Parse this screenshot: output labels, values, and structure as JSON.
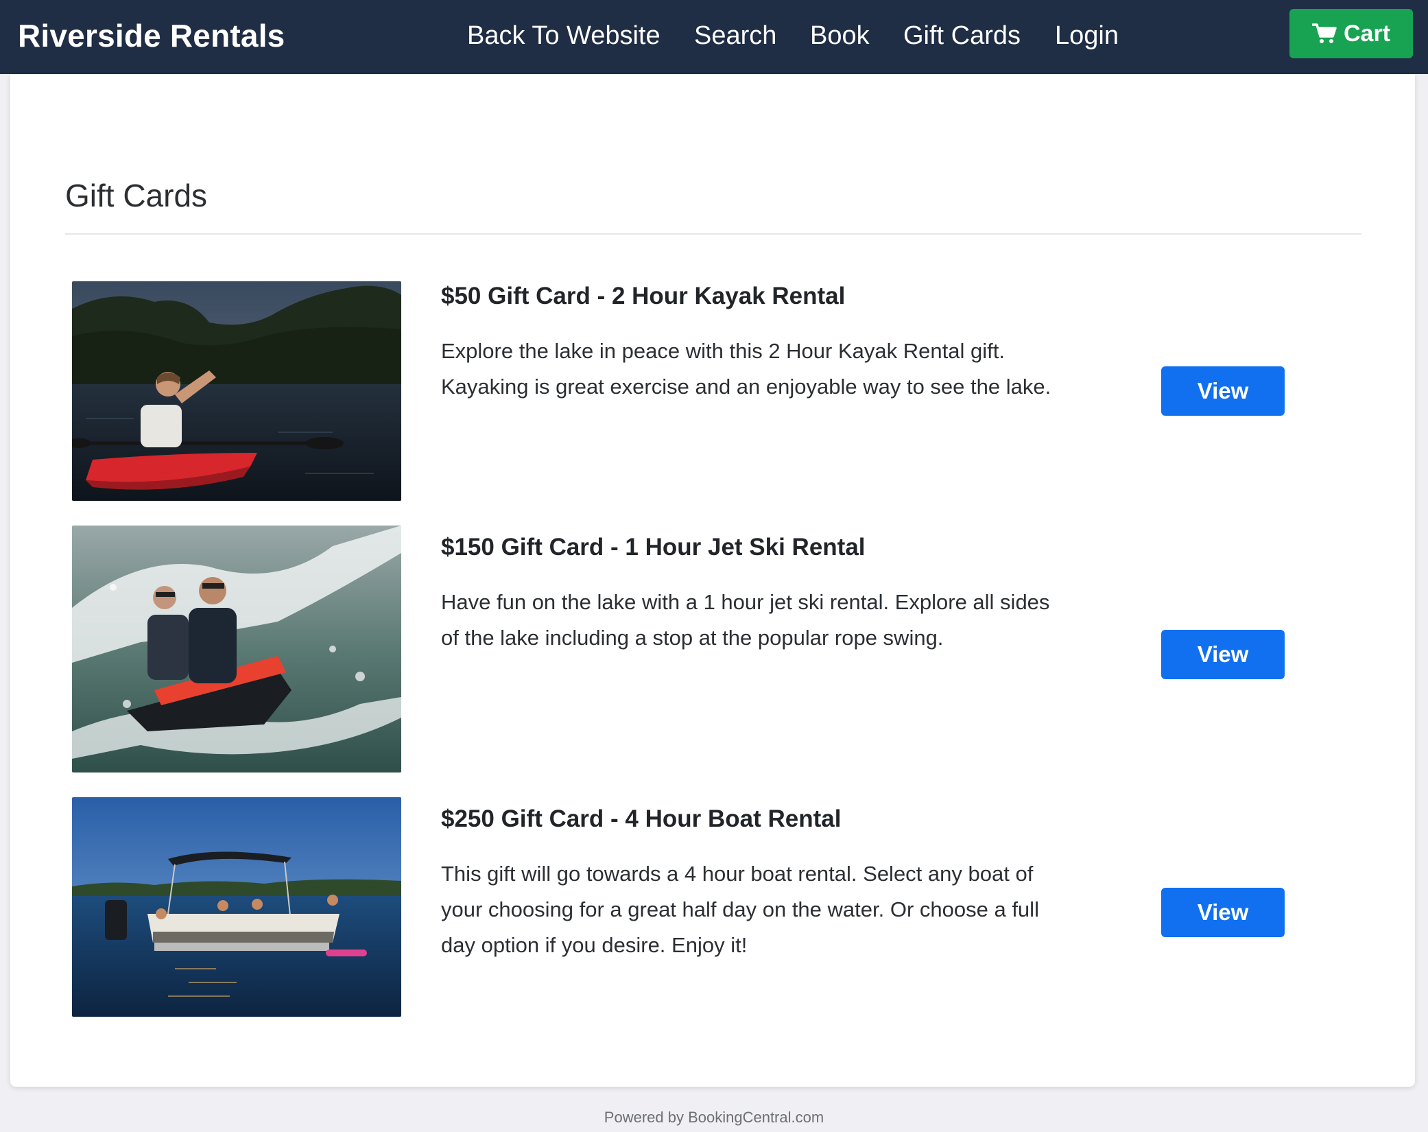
{
  "brand": "Riverside Rentals",
  "nav": {
    "items": [
      {
        "label": "Back To Website"
      },
      {
        "label": "Search"
      },
      {
        "label": "Book"
      },
      {
        "label": "Gift Cards"
      },
      {
        "label": "Login"
      }
    ],
    "cart_label": "Cart",
    "cart_icon": "cart-icon"
  },
  "page": {
    "title": "Gift Cards"
  },
  "gift_cards": [
    {
      "title": "$50 Gift Card - 2 Hour Kayak Rental",
      "description": "Explore the lake in peace with this 2 Hour Kayak Rental gift. Kayaking is great exercise and an enjoyable way to see the lake.",
      "button_label": "View",
      "image": "kayak-photo"
    },
    {
      "title": "$150 Gift Card - 1 Hour Jet Ski Rental",
      "description": "Have fun on the lake with a 1 hour jet ski rental. Explore all sides of the lake including a stop at the popular rope swing.",
      "button_label": "View",
      "image": "jet-ski-photo"
    },
    {
      "title": "$250 Gift Card - 4 Hour Boat Rental",
      "description": "This gift will go towards a 4 hour boat rental. Select any boat of your choosing for a great half day on the water. Or choose a full day option if you desire. Enjoy it!",
      "button_label": "View",
      "image": "pontoon-boat-photo"
    }
  ],
  "footer": "Powered by BookingCentral.com",
  "colors": {
    "navbar": "#1f2d45",
    "cart_button": "#17a352",
    "view_button": "#1170f0"
  }
}
